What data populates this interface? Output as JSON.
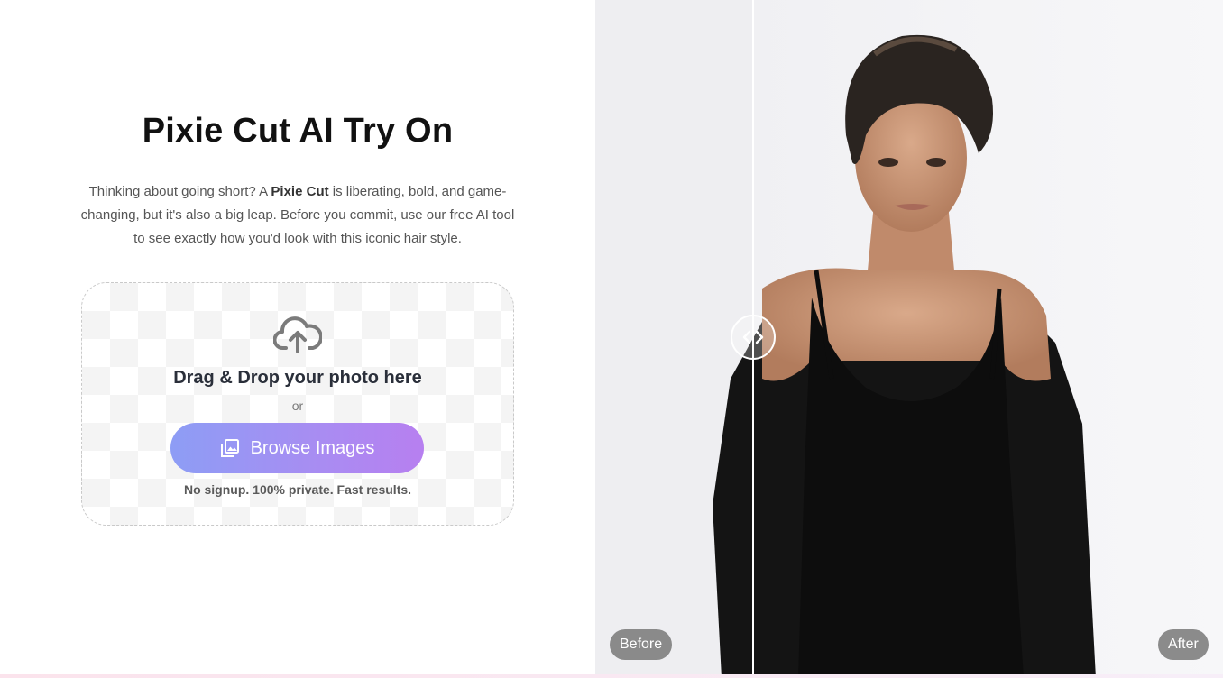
{
  "hero": {
    "title": "Pixie Cut AI Try On",
    "intro_before": "Thinking about going short? A ",
    "intro_bold": "Pixie Cut",
    "intro_after": " is liberating, bold, and game-changing, but it's also a big leap. Before you commit, use our free AI tool to see exactly how you'd look with this iconic hair style."
  },
  "upload": {
    "icon": "cloud-upload-icon",
    "drop_title": "Drag & Drop your photo here",
    "or": "or",
    "browse_label": "Browse Images",
    "browse_icon": "image-gallery-icon",
    "note": "No signup. 100% private. Fast results."
  },
  "compare": {
    "before_label": "Before",
    "after_label": "After",
    "handle_icon": "left-right-arrows-icon",
    "divider_position": 0.25
  },
  "colors": {
    "button_gradient_start": "#8d9df5",
    "button_gradient_end": "#b77ff0",
    "title": "#111111"
  }
}
